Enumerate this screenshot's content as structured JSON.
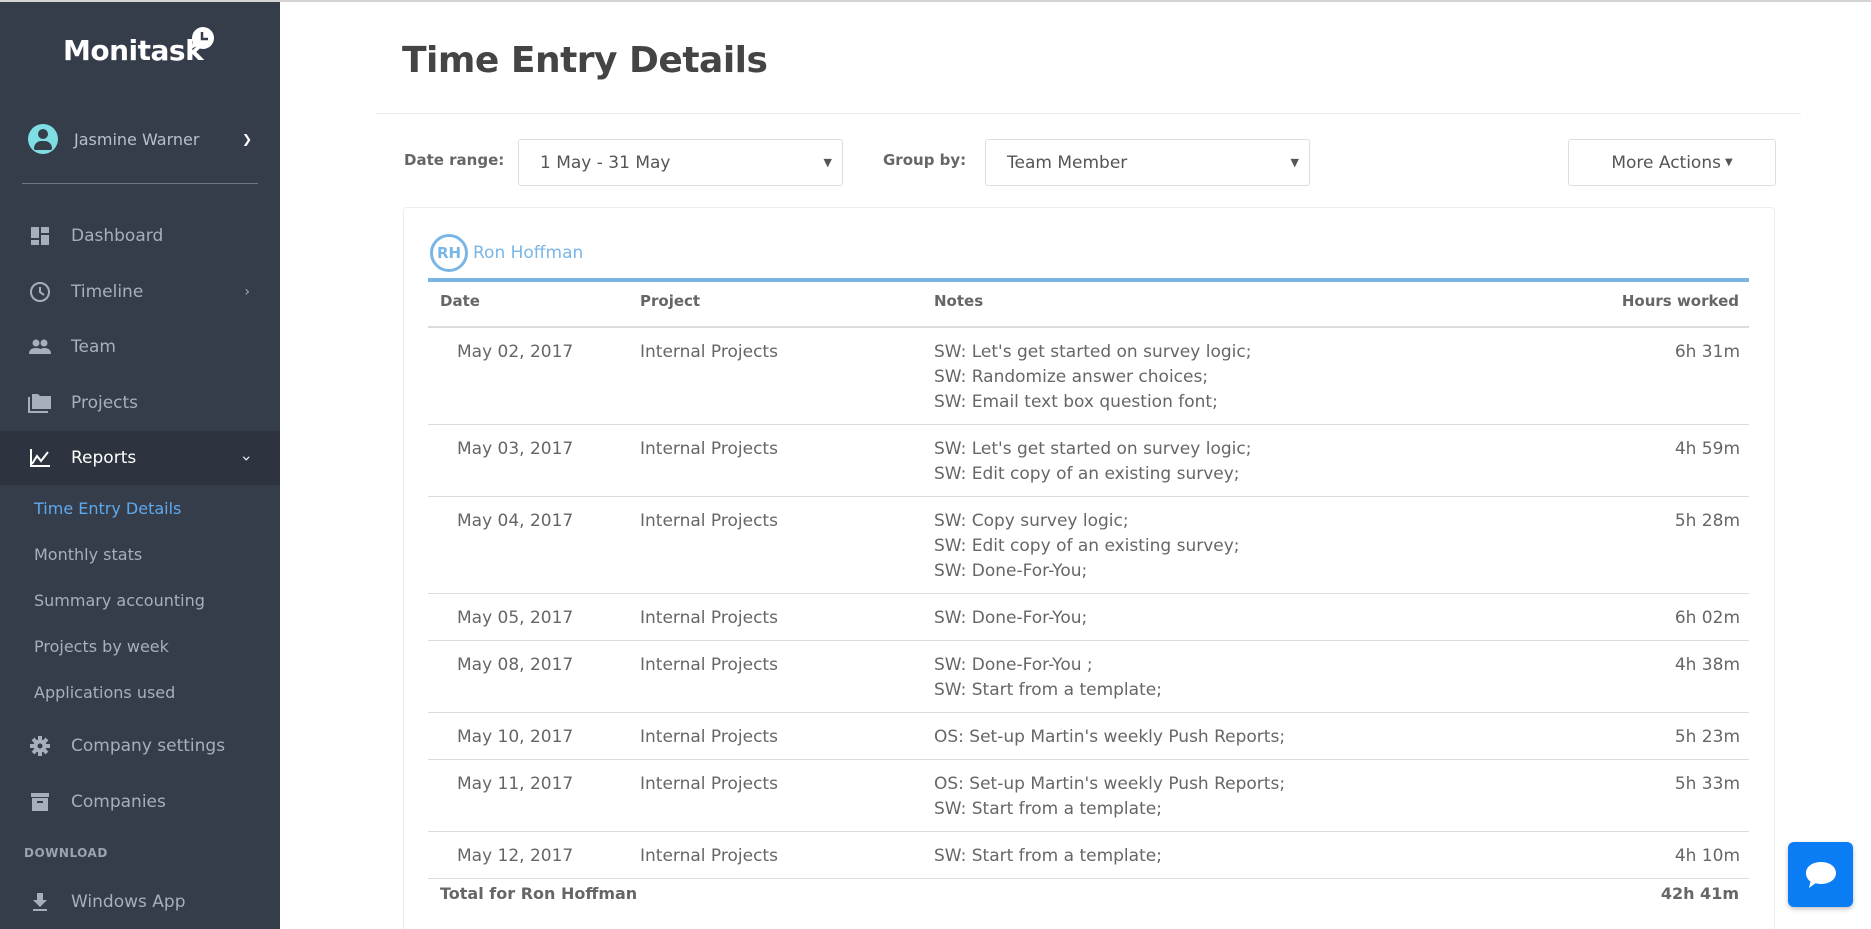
{
  "app": {
    "name": "Monitask"
  },
  "user": {
    "name": "Jasmine Warner"
  },
  "sidebar": {
    "items": [
      {
        "label": "Dashboard",
        "icon": "dashboard-icon"
      },
      {
        "label": "Timeline",
        "icon": "clock-icon"
      },
      {
        "label": "Team",
        "icon": "people-icon"
      },
      {
        "label": "Projects",
        "icon": "folders-icon"
      },
      {
        "label": "Reports",
        "icon": "chart-line-icon",
        "active": true
      },
      {
        "label": "Company settings",
        "icon": "gear-icon"
      },
      {
        "label": "Companies",
        "icon": "archive-box-icon"
      },
      {
        "label": "Windows App",
        "icon": "download-icon"
      }
    ],
    "reports_sub": [
      {
        "label": "Time Entry Details",
        "active": true
      },
      {
        "label": "Monthly stats"
      },
      {
        "label": "Summary accounting"
      },
      {
        "label": "Projects by week"
      },
      {
        "label": "Applications used"
      }
    ],
    "section_download": "DOWNLOAD"
  },
  "page": {
    "title": "Time Entry Details",
    "filters": {
      "date_range_label": "Date range:",
      "date_range_value": "1 May - 31 May",
      "group_by_label": "Group by:",
      "group_by_value": "Team Member"
    },
    "more_actions": "More Actions"
  },
  "report": {
    "member": {
      "initials": "RH",
      "name": "Ron Hoffman"
    },
    "columns": [
      "Date",
      "Project",
      "Notes",
      "Hours worked"
    ],
    "rows": [
      {
        "date": "May 02, 2017",
        "project": "Internal Projects",
        "notes": [
          "SW: Let's get started on survey logic;",
          "SW: Randomize answer choices;",
          "SW: Email text box question font;"
        ],
        "hours": "6h 31m"
      },
      {
        "date": "May 03, 2017",
        "project": "Internal Projects",
        "notes": [
          "SW: Let's get started on survey logic;",
          "SW: Edit copy of an existing survey;"
        ],
        "hours": "4h 59m"
      },
      {
        "date": "May 04, 2017",
        "project": "Internal Projects",
        "notes": [
          "SW: Copy survey logic;",
          "SW: Edit copy of an existing survey;",
          "SW: Done-For-You;"
        ],
        "hours": "5h 28m"
      },
      {
        "date": "May 05, 2017",
        "project": "Internal Projects",
        "notes": [
          "SW: Done-For-You;"
        ],
        "hours": "6h 02m"
      },
      {
        "date": "May 08, 2017",
        "project": "Internal Projects",
        "notes": [
          "SW: Done-For-You ;",
          "SW: Start from a template;"
        ],
        "hours": "4h 38m"
      },
      {
        "date": "May 10, 2017",
        "project": "Internal Projects",
        "notes": [
          "OS: Set-up Martin's weekly Push Reports;"
        ],
        "hours": "5h 23m"
      },
      {
        "date": "May 11, 2017",
        "project": "Internal Projects",
        "notes": [
          "OS: Set-up Martin's weekly Push Reports;",
          "SW: Start from a template;"
        ],
        "hours": "5h 33m"
      },
      {
        "date": "May 12, 2017",
        "project": "Internal Projects",
        "notes": [
          "SW: Start from a template;"
        ],
        "hours": "4h 10m"
      }
    ],
    "total_label": "Total for Ron Hoffman",
    "total_value": "42h 41m"
  },
  "colors": {
    "sidebar_bg": "#353d4a",
    "accent": "#79b6e6",
    "active_link": "#5ea9ee",
    "chat_button": "#0a7cf4"
  }
}
